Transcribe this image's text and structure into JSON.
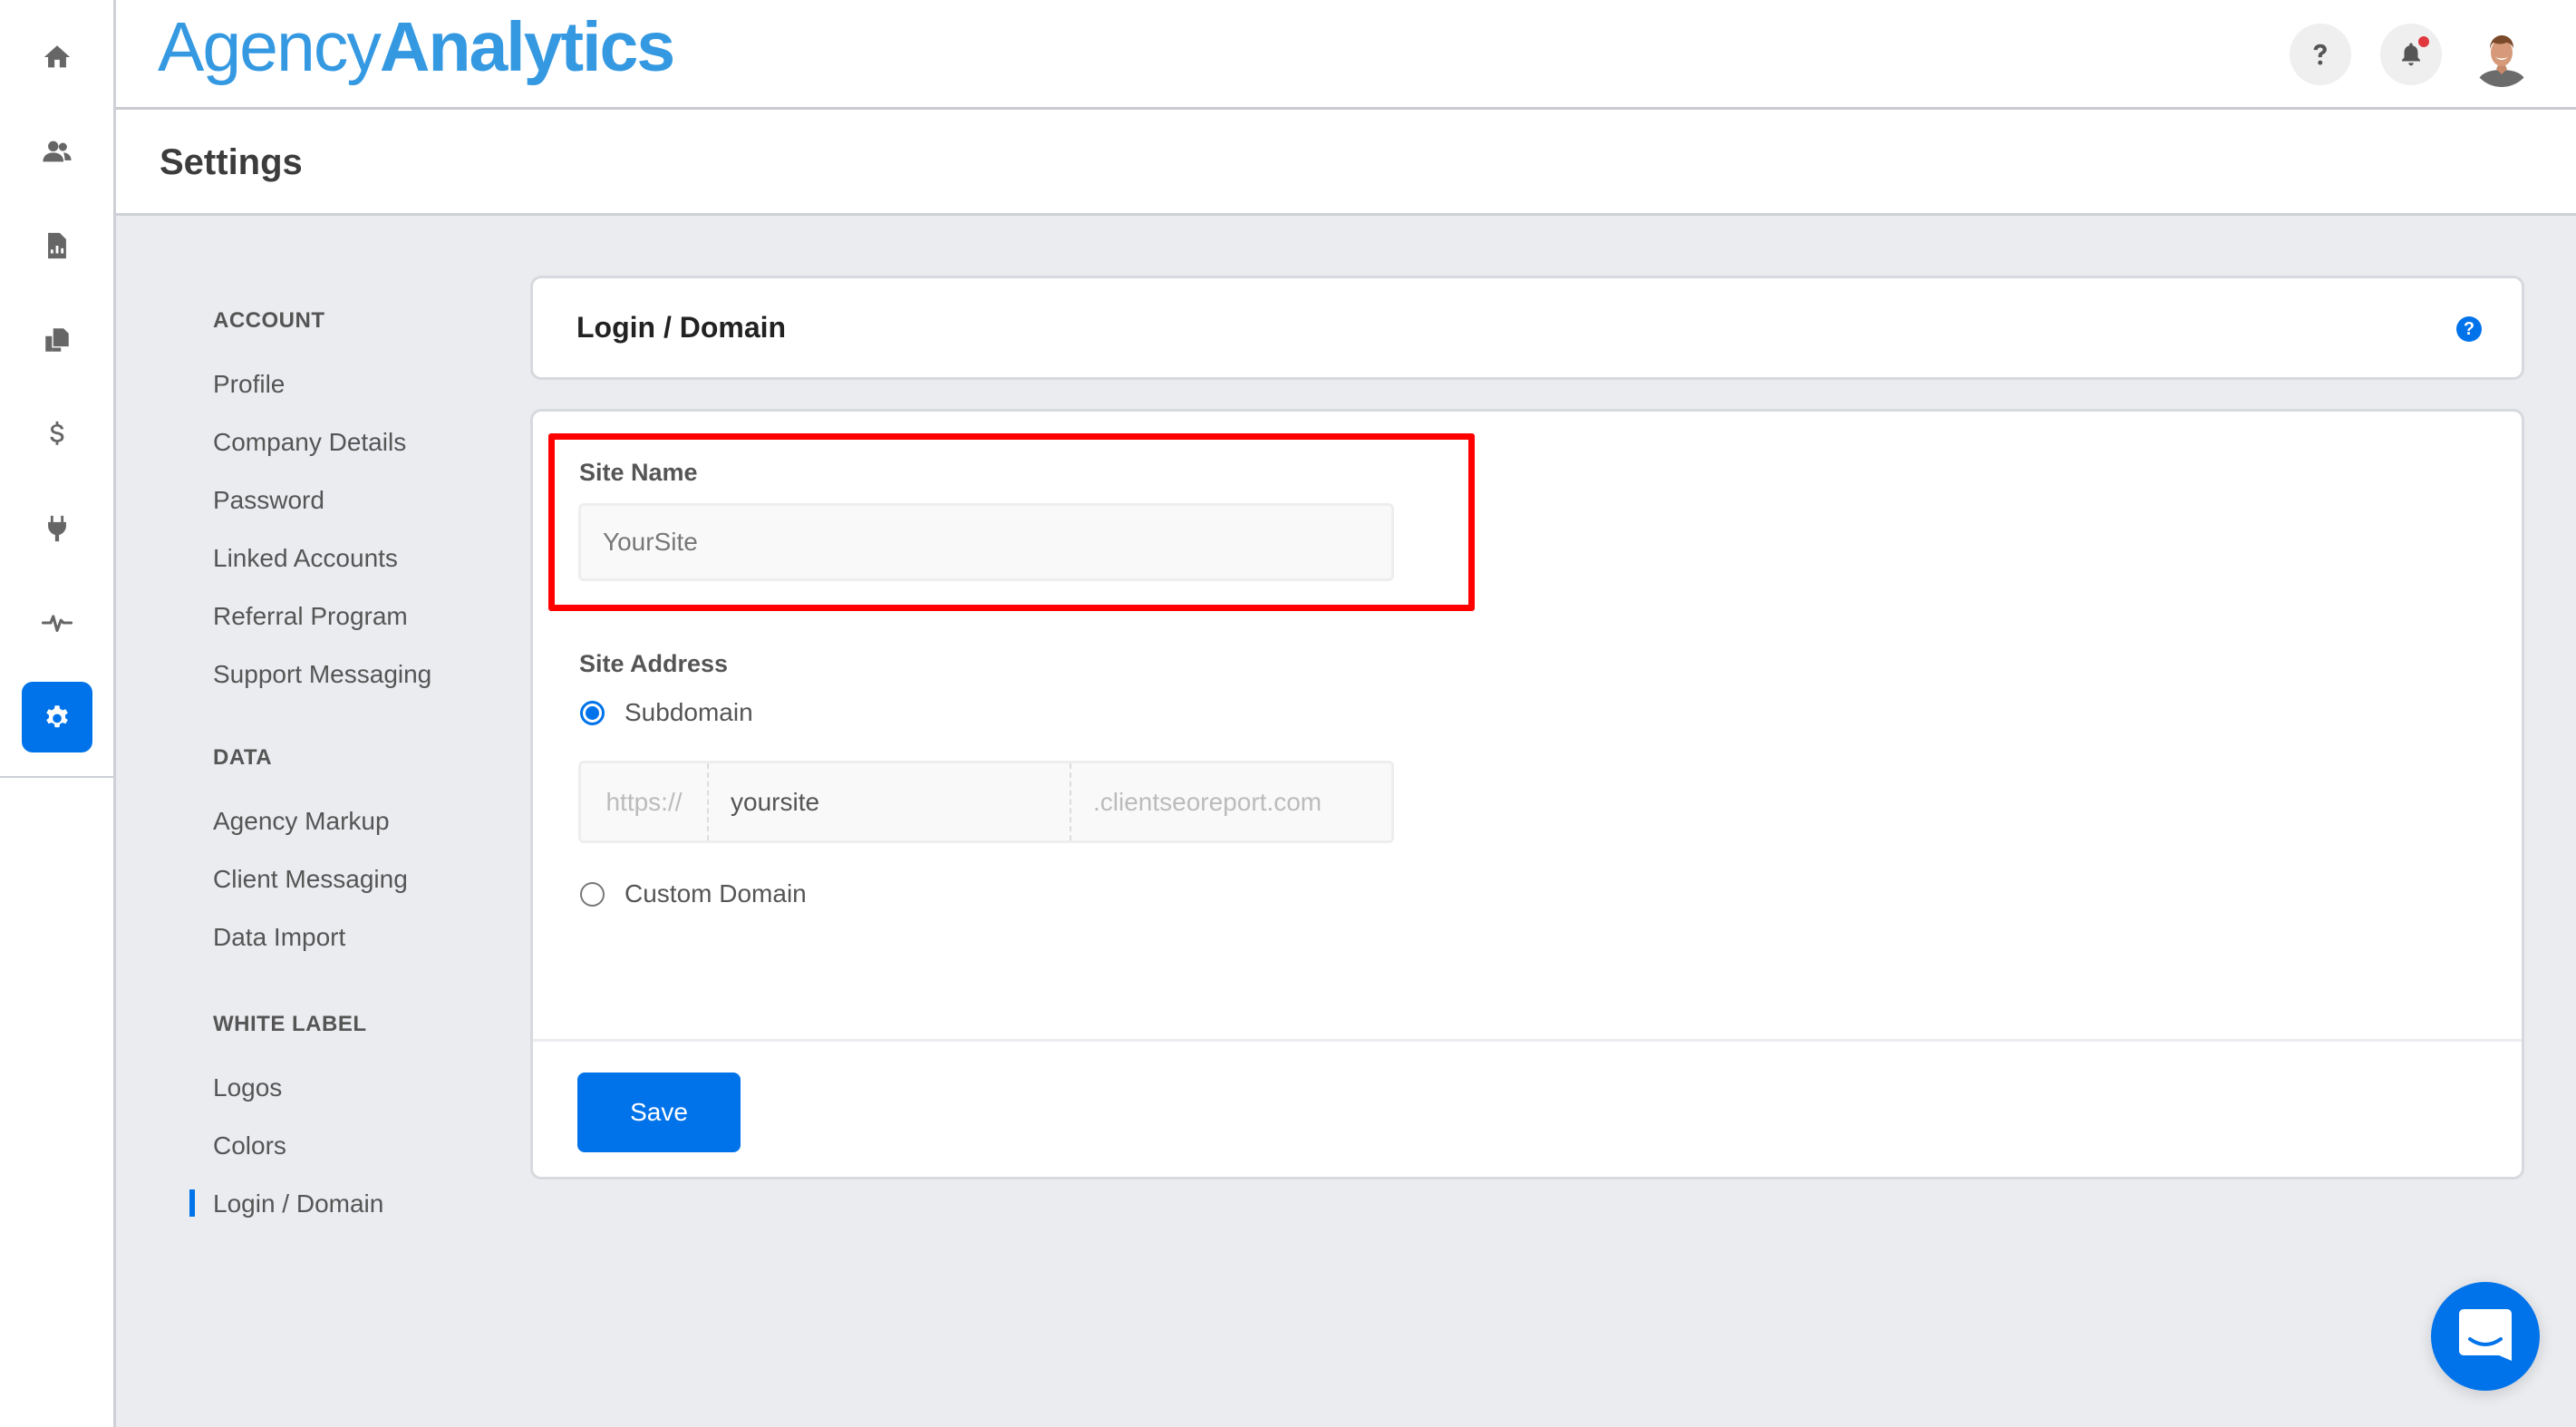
{
  "app": {
    "logo_light": "Agency",
    "logo_bold": "Analytics",
    "brand_color": "#3599e2",
    "accent_color": "#0073ea",
    "highlight_color": "#ff0000"
  },
  "rail": {
    "items": [
      {
        "icon": "home-icon",
        "active": false
      },
      {
        "icon": "users-icon",
        "active": false
      },
      {
        "icon": "report-icon",
        "active": false
      },
      {
        "icon": "documents-icon",
        "active": false
      },
      {
        "icon": "dollar-icon",
        "active": false
      },
      {
        "icon": "plug-icon",
        "active": false
      },
      {
        "icon": "activity-icon",
        "active": false
      },
      {
        "icon": "gear-icon",
        "active": true
      }
    ]
  },
  "topbar": {
    "help_icon": "question-icon",
    "notifications_icon": "bell-icon",
    "has_notification": true,
    "avatar": "user-avatar"
  },
  "page": {
    "title": "Settings"
  },
  "nav": {
    "groups": [
      {
        "heading": "ACCOUNT",
        "items": [
          "Profile",
          "Company Details",
          "Password",
          "Linked Accounts",
          "Referral Program",
          "Support Messaging"
        ]
      },
      {
        "heading": "DATA",
        "items": [
          "Agency Markup",
          "Client Messaging",
          "Data Import"
        ]
      },
      {
        "heading": "WHITE LABEL",
        "items": [
          "Logos",
          "Colors",
          "Login / Domain"
        ]
      }
    ],
    "active_item": "Login / Domain"
  },
  "panel": {
    "title": "Login / Domain",
    "help_glyph": "?",
    "site_name": {
      "label": "Site Name",
      "value": "YourSite"
    },
    "site_address": {
      "label": "Site Address",
      "options": [
        {
          "label": "Subdomain",
          "selected": true
        },
        {
          "label": "Custom Domain",
          "selected": false
        }
      ],
      "prefix": "https://",
      "subdomain_value": "yoursite",
      "suffix": ".clientseoreport.com"
    },
    "save_label": "Save"
  },
  "chat": {
    "icon": "chat-icon"
  }
}
